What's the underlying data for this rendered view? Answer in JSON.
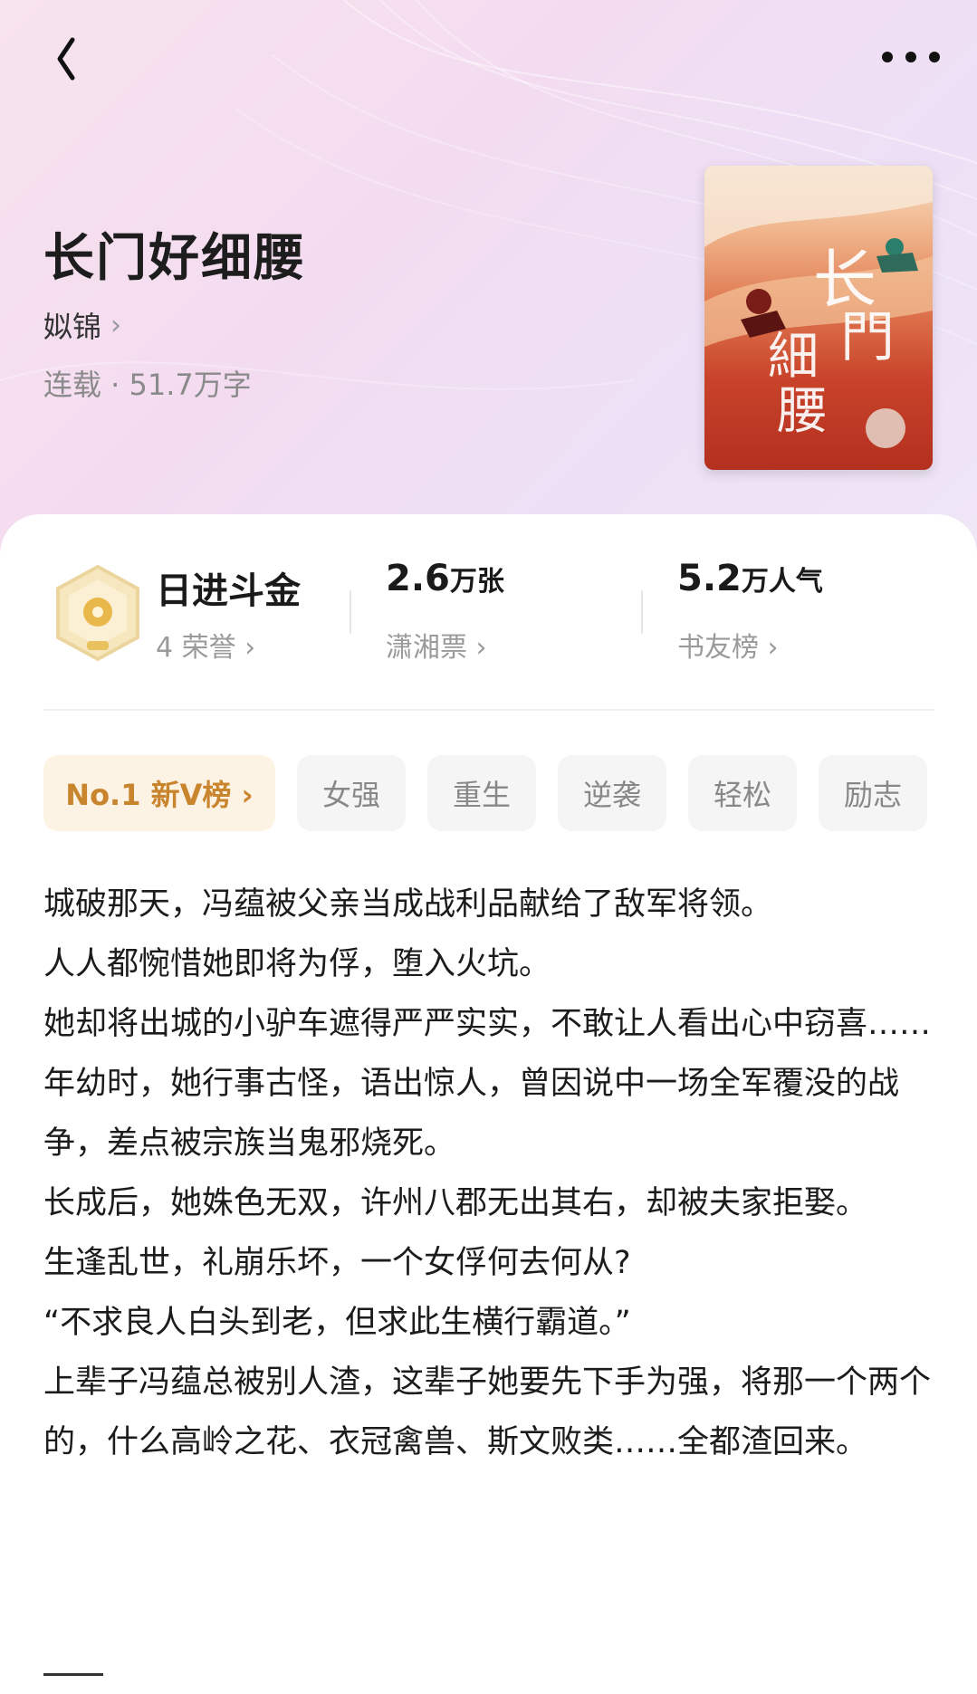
{
  "header": {
    "back_icon": "chevron-left-icon",
    "more_icon": "more-dots-icon"
  },
  "book": {
    "title": "长门好细腰",
    "author": "姒锦",
    "meta": "连载 · 51.7万字"
  },
  "stats": {
    "honor": {
      "title": "日进斗金",
      "sub": "4 荣誉"
    },
    "tickets": {
      "value": "2.6",
      "unit": "万张",
      "sub": "潇湘票"
    },
    "popularity": {
      "value": "5.2",
      "unit": "万人气",
      "sub": "书友榜"
    }
  },
  "tags": {
    "rank": "No.1 新V榜 ›",
    "list": [
      "女强",
      "重生",
      "逆袭",
      "轻松",
      "励志"
    ]
  },
  "description": [
    "城破那天，冯蕴被父亲当成战利品献给了敌军将领。",
    "人人都惋惜她即将为俘，堕入火坑。",
    "她却将出城的小驴车遮得严严实实，不敢让人看出心中窃喜……",
    "年幼时，她行事古怪，语出惊人，曾因说中一场全军覆没的战争，差点被宗族当鬼邪烧死。",
    "长成后，她姝色无双，许州八郡无出其右，却被夫家拒娶。",
    "生逢乱世，礼崩乐坏，一个女俘何去何从?",
    "“不求良人白头到老，但求此生横行霸道。”",
    "上辈子冯蕴总被别人渣，这辈子她要先下手为强，将那一个两个的，什么高岭之花、衣冠禽兽、斯文败类……全都渣回来。"
  ],
  "colors": {
    "accent_gold": "#c9852e",
    "hero_bg": "#f3dcf0"
  }
}
